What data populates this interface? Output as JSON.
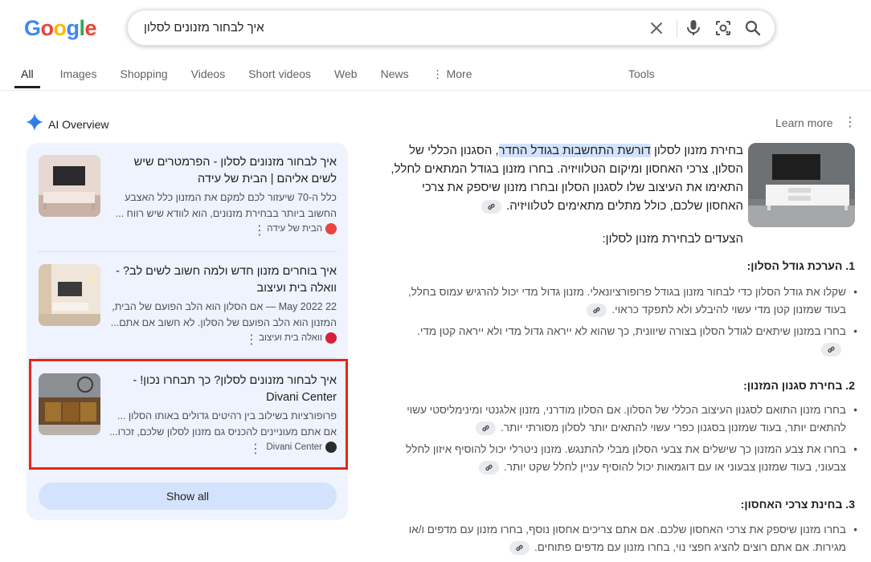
{
  "logo": "Google",
  "search": {
    "query": "איך לבחור מזנונים לסלון"
  },
  "tabs": [
    {
      "label": "All"
    },
    {
      "label": "Images"
    },
    {
      "label": "Shopping"
    },
    {
      "label": "Videos"
    },
    {
      "label": "Short videos"
    },
    {
      "label": "Web"
    },
    {
      "label": "News"
    },
    {
      "label": "More"
    }
  ],
  "tools_label": "Tools",
  "ai_overview": {
    "title": "AI Overview",
    "learn_more": "Learn more",
    "show_all": "Show all",
    "sources": [
      {
        "title": "איך לבחור מזנונים לסלון - הפרמטרים שיש לשים אליהם | הבית של עידה",
        "snippet": "כלל ה-70 שיעזור לכם למקם את המזנון כלל האצבע החשוב ביותר בבחירת מזנונים, הוא לוודא שיש רווח ...",
        "source": "הבית של עידה",
        "favicon_color": "#e8453c"
      },
      {
        "title": "איך בוחרים מזנון חדש ולמה חשוב לשים לב? - וואלה בית ועיצוב",
        "snippet": "22 May 2022 — אם הסלון הוא הלב הפועם של הבית, המזנון הוא הלב הפועם של הסלון. לא חשוב אם אתם...",
        "source": "וואלה בית ועיצוב",
        "favicon_color": "#d6203c"
      },
      {
        "title": "איך לבחור מזנונים לסלון? כך תבחרו נכון! - Divani Center",
        "snippet": "פרופורציות בשילוב בין רהיטים גדולים באותו הסלון ... אם אתם מעוניינים להכניס גם מזנון לסלון שלכם, זכרו...",
        "source": "Divani Center",
        "favicon_color": "#2b2b2b"
      }
    ],
    "intro_before": "בחירת מזנון לסלון ",
    "intro_highlight": "דורשת התחשבות בגודל החדר",
    "intro_after": ", הסגנון הכללי של הסלון, צרכי האחסון ומיקום הטלוויזיה. בחרו מזנון בגודל המתאים לחלל, התאימו את העיצוב שלו לסגנון הסלון ובחרו מזנון שיספק את צרכי האחסון שלכם, כולל מתלים מתאימים לטלוויזיה.",
    "steps_title": "הצעדים לבחירת מזנון לסלון:",
    "sections": [
      {
        "heading": "1. הערכת גודל הסלון:",
        "bullets": [
          "שקלו את גודל הסלון כדי לבחור מזנון בגודל פרופורציונאלי. מזנון גדול מדי יכול להרגיש עמוס בחלל, בעוד שמזנון קטן מדי עשוי להיבלע ולא לתפקד כראוי.",
          "בחרו במזנון שיתאים לגודל הסלון בצורה שיוונית, כך שהוא לא ייראה גדול מדי ולא ייראה קטן מדי."
        ]
      },
      {
        "heading": "2. בחירת סגנון המזנון:",
        "bullets": [
          "בחרו מזנון התואם לסגנון העיצוב הכללי של הסלון. אם הסלון מודרני, מזנון אלגנטי ומינימליסטי עשוי להתאים יותר, בעוד שמזנון בסגנון כפרי עשוי להתאים יותר לסלון מסורתי יותר.",
          "בחרו את צבע המזנון כך שישלים את צבעי הסלון מבלי להתנגש. מזנון ניטרלי יכול להוסיף איזון לחלל צבעוני, בעוד שמזנון צבעוני או עם דוגמאות יכול להוסיף עניין לחלל שקט יותר."
        ]
      },
      {
        "heading": "3. בחינת צרכי האחסון:",
        "bullets": [
          "בחרו מזנון שיספק את צרכי האחסון שלכם. אם אתם צריכים אחסון נוסף, בחרו מזנון עם מדפים ו/או מגירות. אם אתם רוצים להציג חפצי נוי, בחרו מזנון עם מדפים פתוחים."
        ]
      }
    ]
  }
}
